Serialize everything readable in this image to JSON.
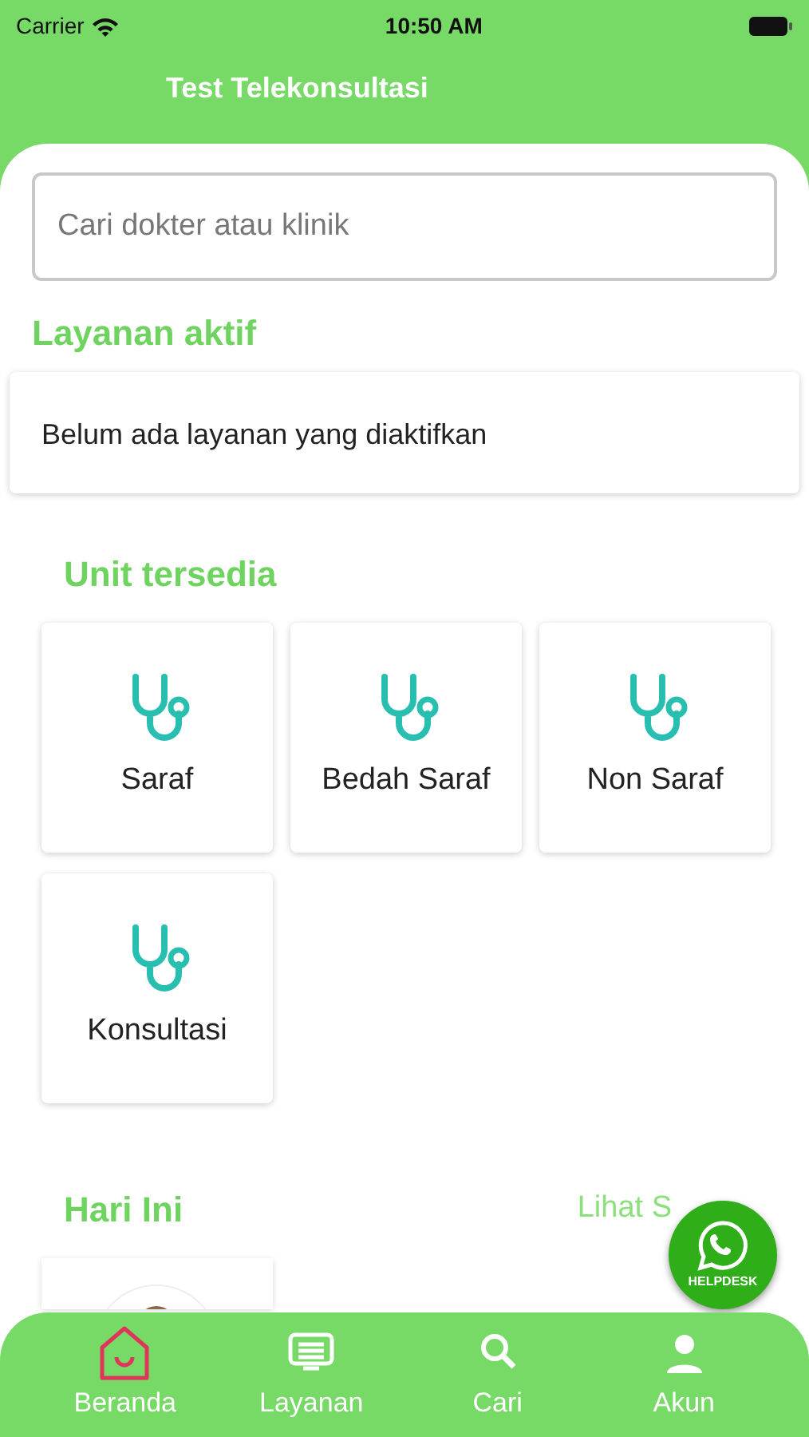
{
  "status_bar": {
    "carrier": "Carrier",
    "time": "10:50 AM"
  },
  "header": {
    "title": "Test Telekonsultasi"
  },
  "search": {
    "placeholder": "Cari dokter atau klinik"
  },
  "active_services": {
    "title": "Layanan aktif",
    "message": "Belum ada layanan yang diaktifkan"
  },
  "units": {
    "title": "Unit tersedia",
    "items": [
      {
        "label": "Saraf"
      },
      {
        "label": "Bedah Saraf"
      },
      {
        "label": "Non Saraf"
      },
      {
        "label": "Konsultasi"
      }
    ]
  },
  "today": {
    "title": "Hari Ini",
    "link": "Lihat S"
  },
  "helpdesk": {
    "label": "HELPDESK"
  },
  "tabs": [
    {
      "label": "Beranda",
      "kind": "home",
      "selected": true
    },
    {
      "label": "Layanan",
      "kind": "list",
      "selected": false
    },
    {
      "label": "Cari",
      "kind": "search",
      "selected": false
    },
    {
      "label": "Akun",
      "kind": "person",
      "selected": false
    }
  ]
}
